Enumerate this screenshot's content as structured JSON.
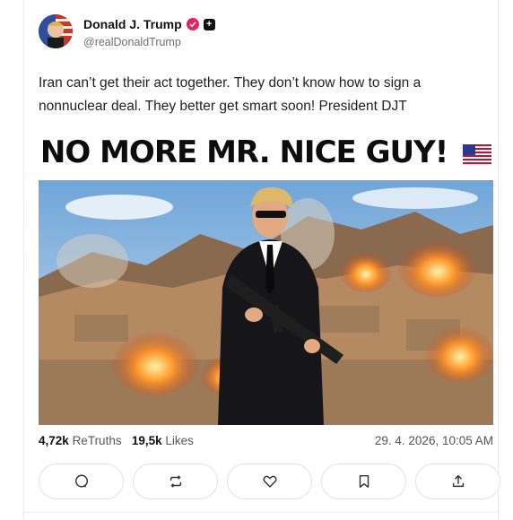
{
  "post": {
    "author_name": "Donald J. Trump",
    "author_handle": "@realDonaldTrump",
    "text": "Iran can’t get their act together. They don’t know how to sign a nonnuclear deal. They better get smart soon! President DJT",
    "meme_title": "NO MORE MR. NICE GUY!",
    "image_icon": "flag-icon"
  },
  "stats": {
    "retruths_count": "4,72k",
    "retruths_label": "ReTruths",
    "likes_count": "19,5k",
    "likes_label": "Likes",
    "timestamp": "29. 4. 2026, 10:05 AM"
  },
  "actions": [
    "reply-icon",
    "retruth-icon",
    "like-icon",
    "bookmark-icon",
    "share-icon"
  ],
  "colors": {
    "verified_badge": "#e0245e",
    "text": "#1f1f1f",
    "muted": "#6f6f6f"
  }
}
